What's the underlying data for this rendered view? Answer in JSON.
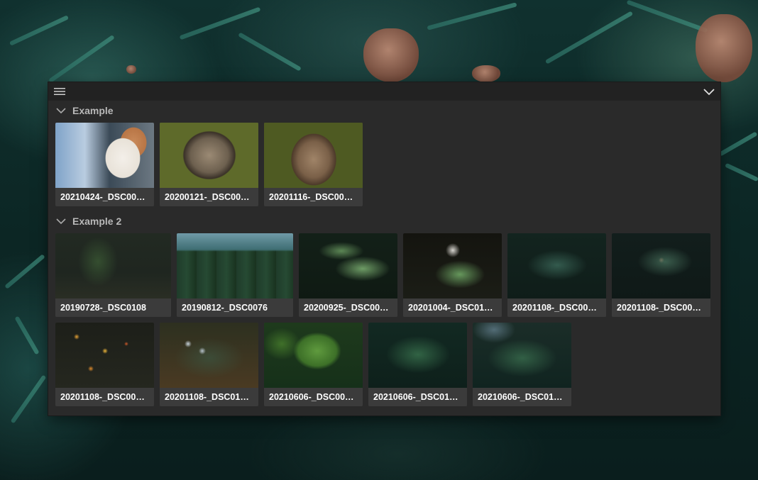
{
  "toolbar": {
    "menu_icon": "hamburger-menu-icon",
    "collapse_icon": "chevron-down-icon"
  },
  "sections": [
    {
      "label": "Example",
      "items": [
        {
          "caption": "20210424-_DSC00…"
        },
        {
          "caption": "20200121-_DSC00…"
        },
        {
          "caption": "20201116-_DSC00…"
        }
      ]
    },
    {
      "label": "Example 2",
      "items": [
        {
          "caption": "20190728-_DSC0108"
        },
        {
          "caption": "20190812-_DSC0076"
        },
        {
          "caption": "20200925-_DSC00…"
        },
        {
          "caption": "20201004-_DSC01…"
        },
        {
          "caption": "20201108-_DSC00…"
        },
        {
          "caption": "20201108-_DSC00…"
        },
        {
          "caption": "20201108-_DSC00…"
        },
        {
          "caption": "20201108-_DSC01…"
        },
        {
          "caption": "20210606-_DSC00…"
        },
        {
          "caption": "20210606-_DSC01…"
        },
        {
          "caption": "20210606-_DSC01…"
        }
      ]
    }
  ]
}
